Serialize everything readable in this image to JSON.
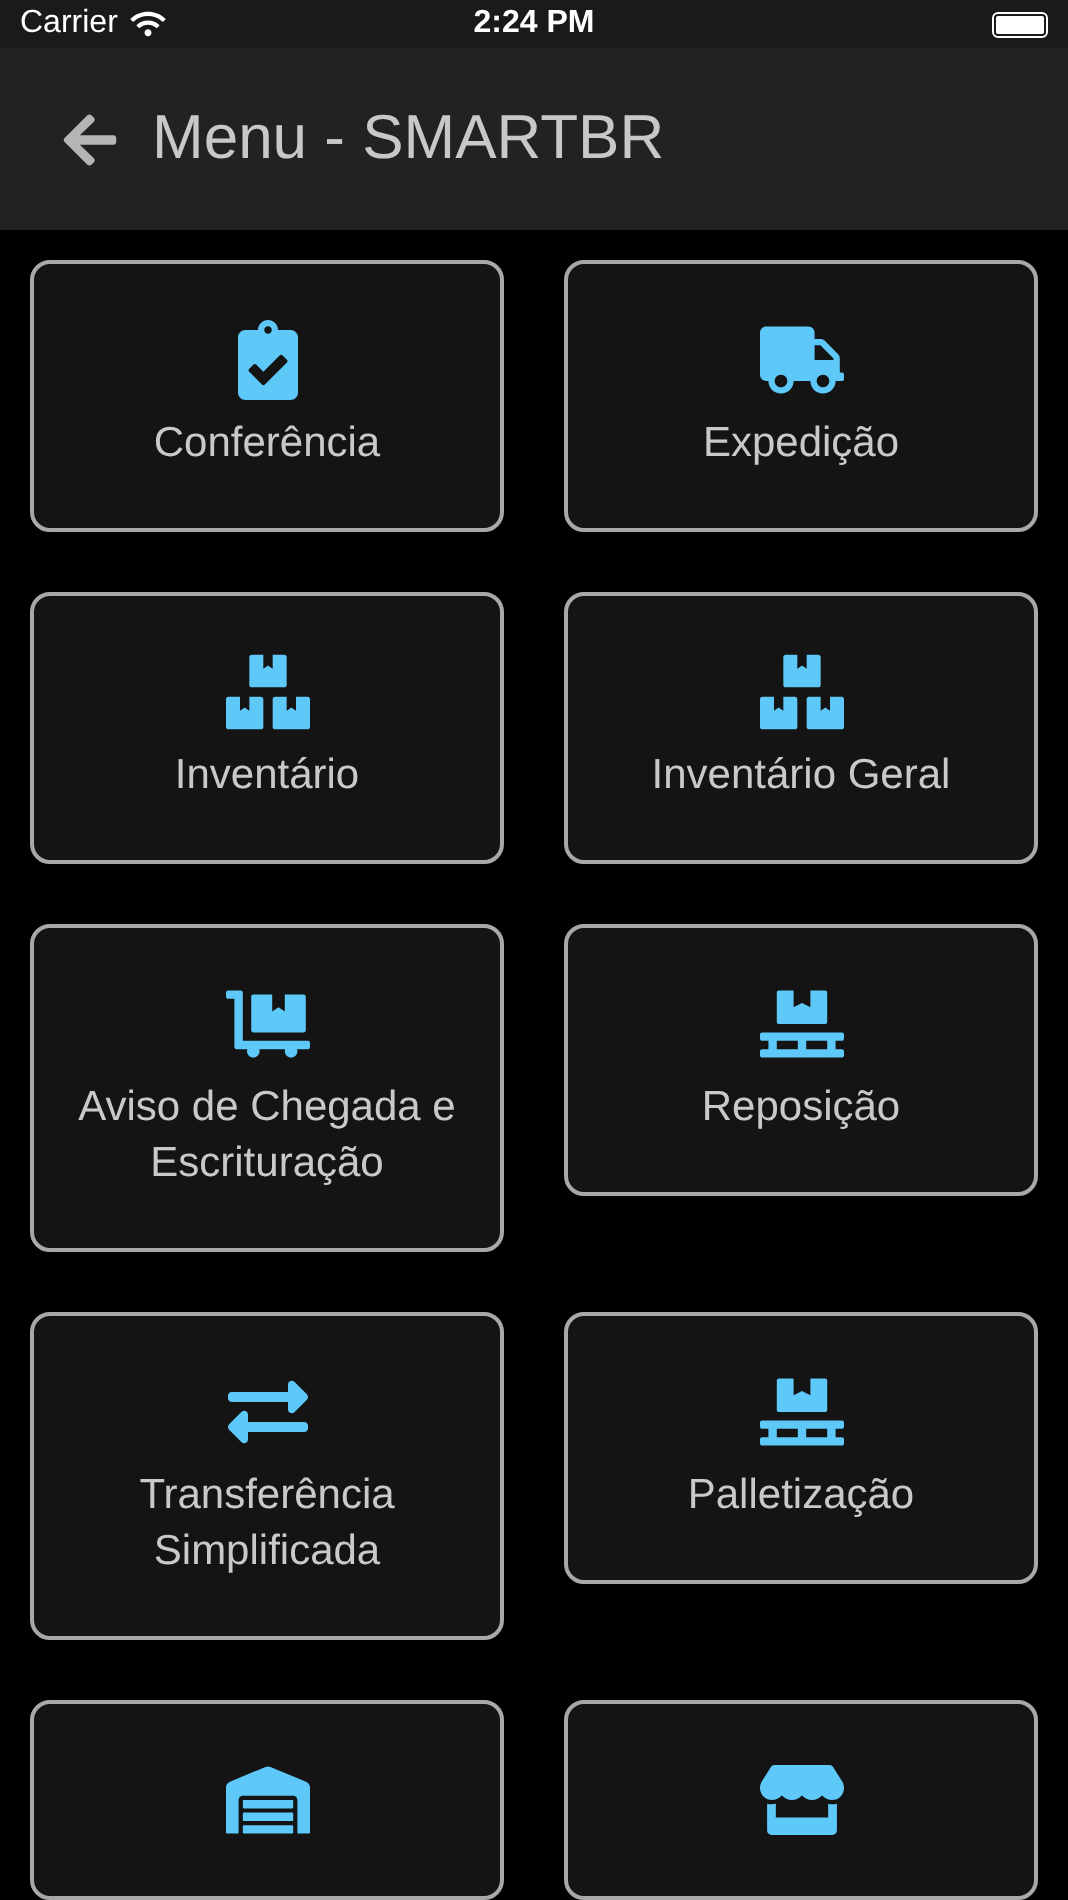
{
  "status_bar": {
    "carrier": "Carrier",
    "time": "2:24 PM"
  },
  "header": {
    "title": "Menu - SMARTBR"
  },
  "menu": [
    {
      "kind": "clipboard",
      "label": "Conferência"
    },
    {
      "kind": "truck",
      "label": "Expedição"
    },
    {
      "kind": "boxes",
      "label": "Inventário"
    },
    {
      "kind": "boxes",
      "label": "Inventário Geral"
    },
    {
      "kind": "dolly",
      "label": "Aviso de Chegada e Escrituração"
    },
    {
      "kind": "pallet",
      "label": "Reposição"
    },
    {
      "kind": "transfer",
      "label": "Transferência Simplificada"
    },
    {
      "kind": "pallet",
      "label": "Palletização"
    },
    {
      "kind": "warehouse"
    },
    {
      "kind": "store"
    }
  ]
}
